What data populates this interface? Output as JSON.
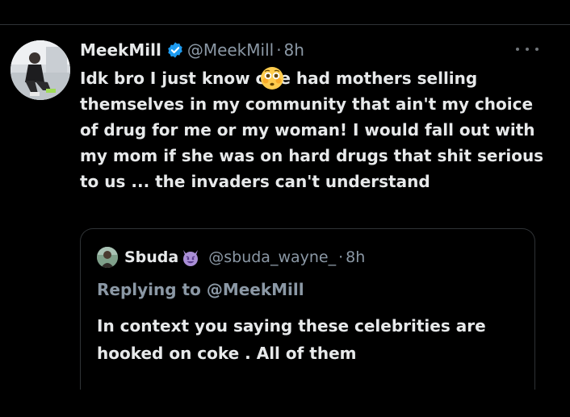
{
  "tweet": {
    "author_name": "MeekMill",
    "handle": "@MeekMill",
    "separator": "·",
    "time": "8h",
    "text_before_emoji": "Idk bro I just know c",
    "text_after_emoji": "e had mothers selling themselves in my community that ain't my choice of drug for me or my woman! I would fall out with my mom if she was on hard drugs that shit serious to us ... the invaders can't understand",
    "emoji_icon": "flushed-face-emoji",
    "verified_color": "#1d9bf0"
  },
  "quoted_tweet": {
    "author_name": "Sbuda",
    "name_emoji_icon": "smiling-devil-emoji",
    "handle": "@sbuda_wayne_",
    "separator": "·",
    "time": "8h",
    "replying_prefix": "Replying to ",
    "replying_mention": "@MeekMill",
    "text": "In context you saying these celebrities are hooked on coke . All of them"
  },
  "colors": {
    "background": "#000000",
    "primary_text": "#e7e9ea",
    "secondary_text": "#8b98a5",
    "border": "#2f3336"
  }
}
